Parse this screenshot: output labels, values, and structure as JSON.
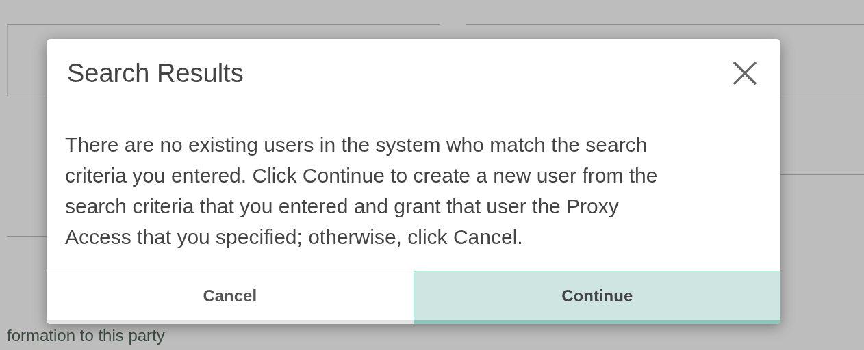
{
  "background": {
    "footer_text": "formation to this party"
  },
  "dialog": {
    "title": "Search Results",
    "message": "There are no existing users in the system who match the search criteria you entered. Click Continue to create a new user from the search criteria that you entered and grant that user the Proxy Access that you specified; otherwise, click Cancel.",
    "buttons": [
      {
        "label": "Cancel",
        "kind": "secondary"
      },
      {
        "label": "Continue",
        "kind": "primary"
      }
    ]
  }
}
